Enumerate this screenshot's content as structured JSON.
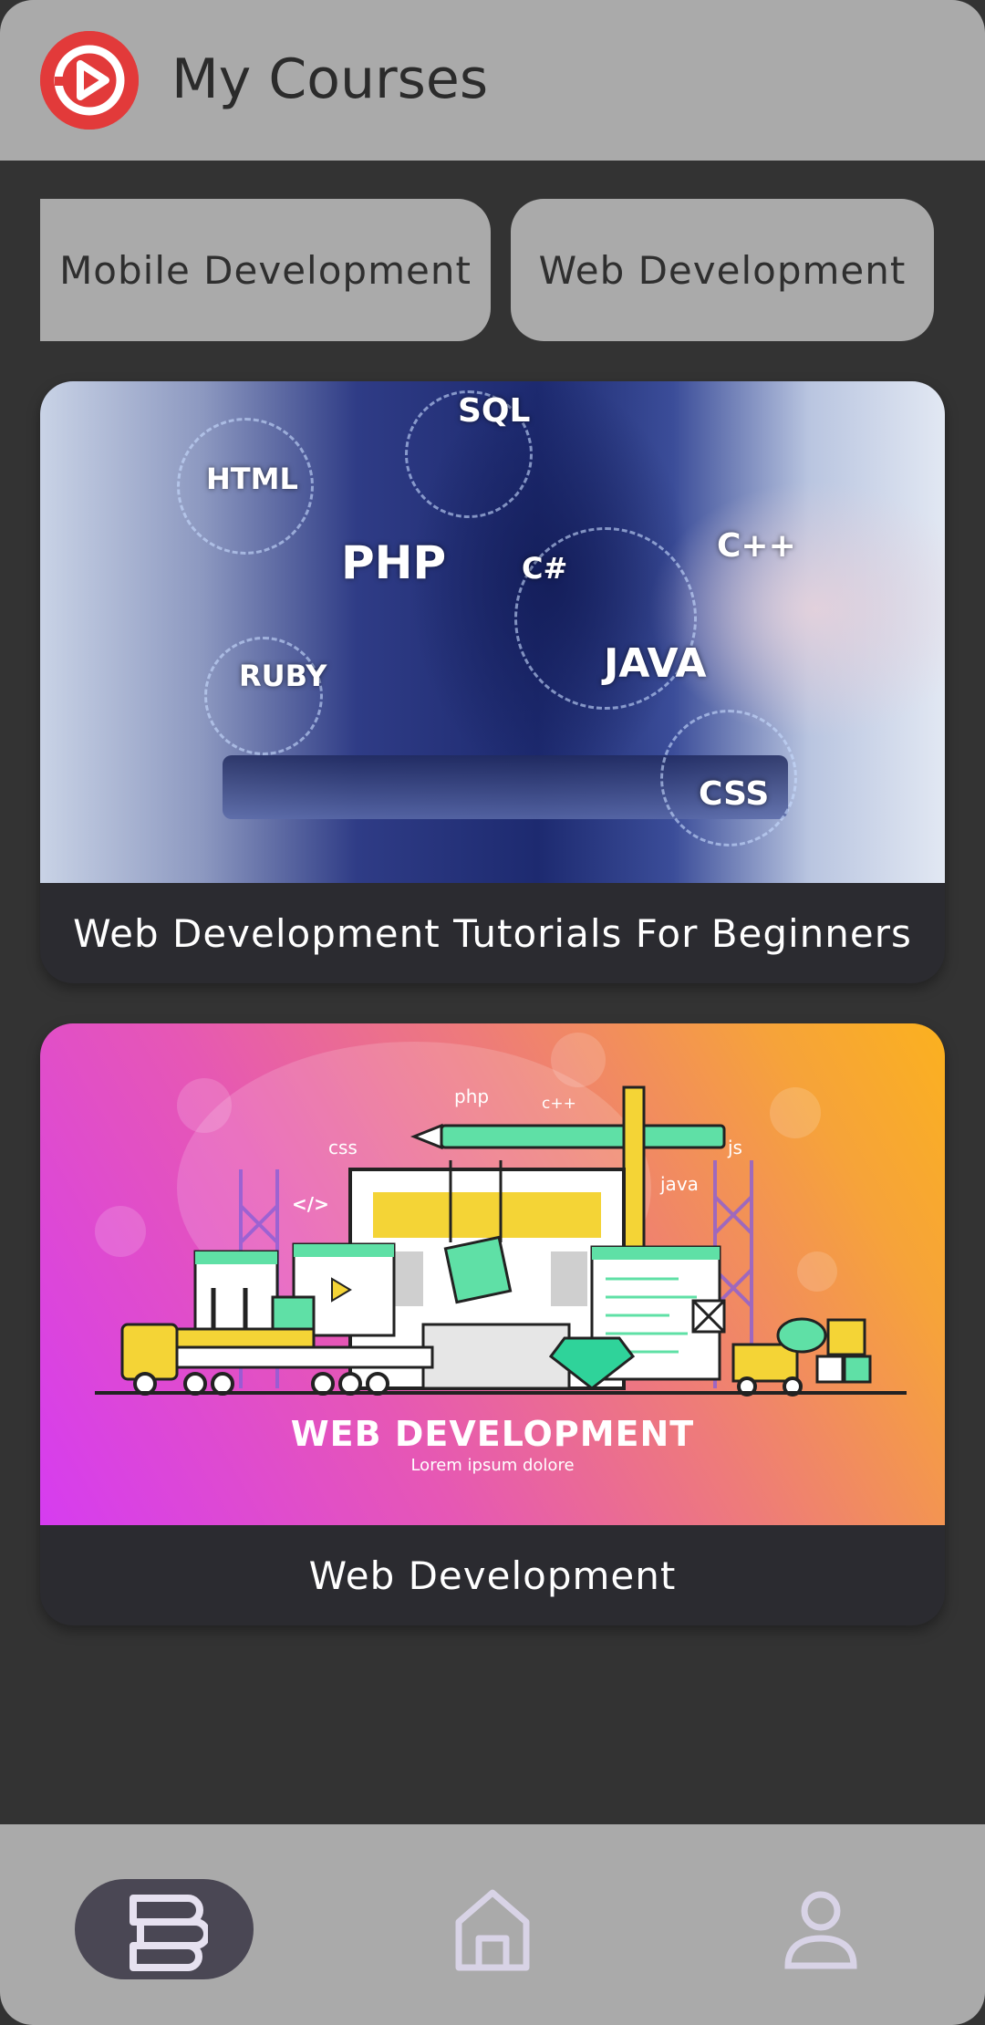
{
  "appbar": {
    "title": "My Courses",
    "logo_icon": "play-logo-icon",
    "logo_color": "#e23a3a"
  },
  "categories": [
    {
      "label": "Mobile Development"
    },
    {
      "label": "Web Development"
    }
  ],
  "courses": [
    {
      "title": "Web Development Tutorials For Beginners",
      "image_tags": [
        "SQL",
        "HTML",
        "PHP",
        "C#",
        "C++",
        "JAVA",
        "RUBY",
        "CSS"
      ]
    },
    {
      "title": "Web Development",
      "image_tags": [
        "php",
        "c++",
        "css",
        "js",
        "java",
        "</>"
      ],
      "image_headline": "WEB DEVELOPMENT",
      "image_subline": "Lorem ipsum dolore"
    }
  ],
  "bottom_nav": [
    {
      "icon": "courses-stack-icon",
      "active": true
    },
    {
      "icon": "home-icon",
      "active": false
    },
    {
      "icon": "profile-icon",
      "active": false
    }
  ],
  "colors": {
    "background": "#333333",
    "bar": "#aaaaaa",
    "card": "#2b2b30",
    "nav_active": "#4a4754",
    "nav_icon": "#d8d3e6"
  }
}
